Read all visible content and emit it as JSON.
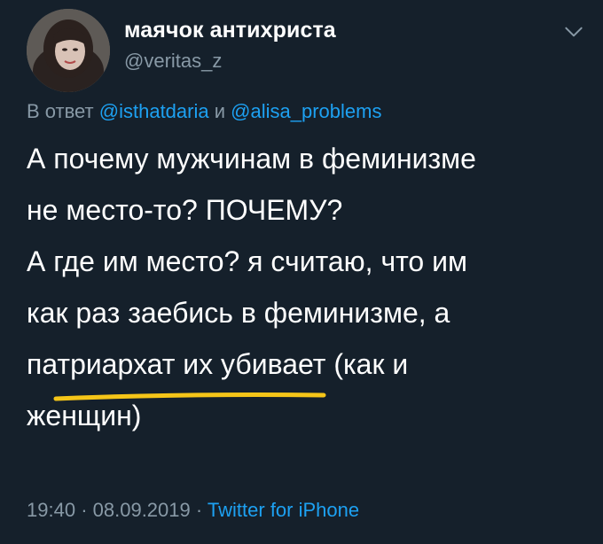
{
  "tweet": {
    "display_name": "маячок антихриста",
    "handle": "@veritas_z",
    "reply_prefix": "В ответ",
    "reply_user_1": "@isthatdaria",
    "reply_joiner": "и",
    "reply_user_2": "@alisa_problems",
    "lines": [
      "А почему мужчинам в феминизме",
      "не место-то? ПОЧЕМУ?",
      "А где им место? я считаю, что им",
      "как раз заебись в феминизме, а",
      "патриархат их убивает (как и",
      "женщин)"
    ],
    "time": "19:40",
    "date": "08.09.2019",
    "separator": "·",
    "source": "Twitter for iPhone"
  },
  "colors": {
    "background": "#15202b",
    "text": "#ffffff",
    "muted": "#8899a6",
    "link": "#1da1f2",
    "highlight_underline": "#f5c518"
  },
  "icons": {
    "avatar": "profile-photo",
    "menu": "chevron-down-icon"
  }
}
